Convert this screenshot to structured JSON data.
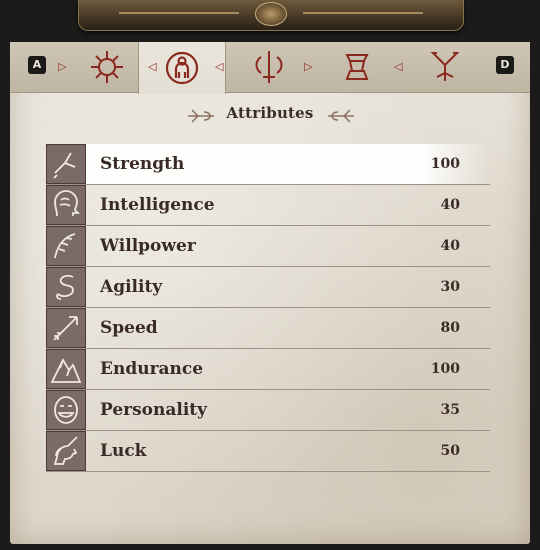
{
  "header": {
    "left_key": "A",
    "right_key": "D"
  },
  "tabs": [
    {
      "icon": "sun-emblem-icon",
      "active": false
    },
    {
      "icon": "character-portrait-icon",
      "active": true
    },
    {
      "icon": "sword-scroll-icon",
      "active": false
    },
    {
      "icon": "anvil-icon",
      "active": false
    },
    {
      "icon": "flowers-icon",
      "active": false
    }
  ],
  "section": {
    "title": "Attributes"
  },
  "attributes": [
    {
      "name": "Strength",
      "value": "100",
      "icon": "strength-arm-icon"
    },
    {
      "name": "Intelligence",
      "value": "40",
      "icon": "brain-head-icon"
    },
    {
      "name": "Willpower",
      "value": "40",
      "icon": "feather-hand-icon"
    },
    {
      "name": "Agility",
      "value": "30",
      "icon": "serpent-icon"
    },
    {
      "name": "Speed",
      "value": "80",
      "icon": "arrow-icon"
    },
    {
      "name": "Endurance",
      "value": "100",
      "icon": "mountain-icon"
    },
    {
      "name": "Personality",
      "value": "35",
      "icon": "mask-face-icon"
    },
    {
      "name": "Luck",
      "value": "50",
      "icon": "unicorn-icon"
    }
  ],
  "selected_index": 0,
  "colors": {
    "parchment": "#e6e1d7",
    "ink": "#3a2a26",
    "accent": "#8a2a1f",
    "icon_tile": "#7a6a68"
  }
}
